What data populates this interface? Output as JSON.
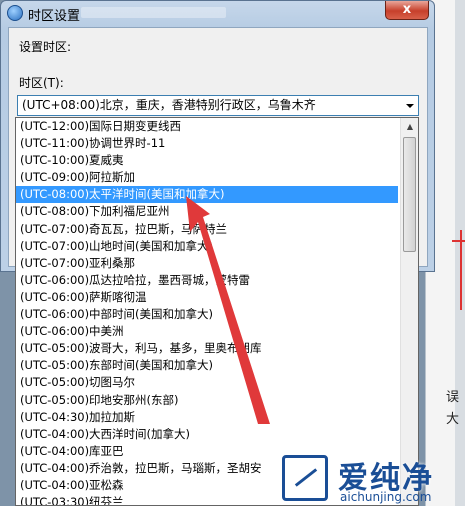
{
  "background": {
    "side_text_1": "误",
    "side_text_2": "大"
  },
  "window": {
    "title": "时区设置",
    "close_label": "x"
  },
  "dialog": {
    "set_tz_label": "设置时区:",
    "tz_label": "时区(T):",
    "current_value": "(UTC+08:00)北京，重庆，香港特别行政区，乌鲁木齐"
  },
  "dropdown": {
    "selected_index": 4,
    "items": [
      "(UTC-12:00)国际日期变更线西",
      "(UTC-11:00)协调世界时-11",
      "(UTC-10:00)夏威夷",
      "(UTC-09:00)阿拉斯加",
      "(UTC-08:00)太平洋时间(美国和加拿大)",
      "(UTC-08:00)下加利福尼亚州",
      "(UTC-07:00)奇瓦瓦，拉巴斯，马萨特兰",
      "(UTC-07:00)山地时间(美国和加拿大)",
      "(UTC-07:00)亚利桑那",
      "(UTC-06:00)瓜达拉哈拉，墨西哥城，蒙特雷",
      "(UTC-06:00)萨斯喀彻温",
      "(UTC-06:00)中部时间(美国和加拿大)",
      "(UTC-06:00)中美洲",
      "(UTC-05:00)波哥大，利马，基多，里奥布朗库",
      "(UTC-05:00)东部时间(美国和加拿大)",
      "(UTC-05:00)切图马尔",
      "(UTC-05:00)印地安那州(东部)",
      "(UTC-04:30)加拉加斯",
      "(UTC-04:00)大西洋时间(加拿大)",
      "(UTC-04:00)库亚巴",
      "(UTC-04:00)乔治敦，拉巴斯，马瑙斯，圣胡安",
      "(UTC-04:00)亚松森",
      "(UTC-03:30)纽芬兰"
    ]
  },
  "colors": {
    "selection": "#3399ff",
    "arrow": "#e0393a",
    "watermark": "#1a4e96"
  },
  "watermark": {
    "cn": "爱纯净",
    "url": "aichunjing.com"
  }
}
